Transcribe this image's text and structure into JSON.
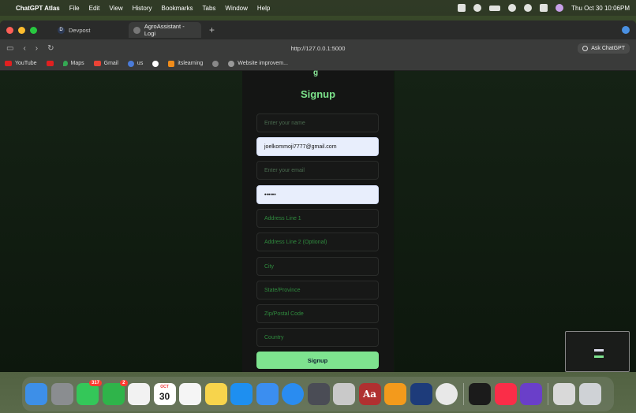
{
  "menubar": {
    "app_name": "ChatGPT Atlas",
    "menus": [
      "File",
      "Edit",
      "View",
      "History",
      "Bookmarks",
      "Tabs",
      "Window",
      "Help"
    ],
    "clock": "Thu Oct 30  10:06PM"
  },
  "browser": {
    "tabs": [
      {
        "label": "Devpost",
        "icon": "devpost-icon"
      },
      {
        "label": "AgroAssistant - Logi",
        "icon": "compass-icon"
      }
    ],
    "url": "http://127.0.0.1:5000",
    "ask_button": "Ask ChatGPT",
    "bookmarks": [
      {
        "label": "YouTube",
        "icon": "youtube-icon",
        "color": "#e02020"
      },
      {
        "label": "",
        "icon": "youtube-icon",
        "color": "#e02020"
      },
      {
        "label": "Maps",
        "icon": "maps-icon",
        "color": "#34a853"
      },
      {
        "label": "Gmail",
        "icon": "gmail-icon",
        "color": "#ea4335"
      },
      {
        "label": "us",
        "icon": "user-icon",
        "color": "#4a7bd8"
      },
      {
        "label": "",
        "icon": "google-icon",
        "color": "#ffffff"
      },
      {
        "label": "itslearning",
        "icon": "itslearning-icon",
        "color": "#f08c1a"
      },
      {
        "label": "",
        "icon": "compass-icon",
        "color": "#aaaaaa"
      },
      {
        "label": "Website improvem...",
        "icon": "gear-icon",
        "color": "#aaaaaa"
      }
    ]
  },
  "form": {
    "title": "Signup",
    "logo_fragment": "g",
    "fields": [
      {
        "name": "name-field",
        "value": "",
        "placeholder": "Enter your name",
        "filled": false
      },
      {
        "name": "username-field",
        "value": "joelkommoji7777@gmail.com",
        "placeholder": "",
        "filled": true
      },
      {
        "name": "email-field",
        "value": "",
        "placeholder": "Enter your email",
        "filled": false
      },
      {
        "name": "password-field",
        "value": "••••••",
        "placeholder": "",
        "filled": true
      },
      {
        "name": "address-line1-field",
        "value": "",
        "placeholder": "Address Line 1",
        "filled": false
      },
      {
        "name": "address-line2-field",
        "value": "",
        "placeholder": "Address Line 2 (Optional)",
        "filled": false
      },
      {
        "name": "city-field",
        "value": "",
        "placeholder": "City",
        "filled": false
      },
      {
        "name": "state-field",
        "value": "",
        "placeholder": "State/Province",
        "filled": false
      },
      {
        "name": "zip-field",
        "value": "",
        "placeholder": "Zip/Postal Code",
        "filled": false
      },
      {
        "name": "country-field",
        "value": "",
        "placeholder": "Country",
        "filled": false
      }
    ],
    "submit_label": "Signup"
  },
  "dock": {
    "apps": [
      {
        "icon": "finder-icon",
        "color": "#3d8fe8",
        "badge": ""
      },
      {
        "icon": "system-settings-icon",
        "color": "#8a8d90",
        "badge": ""
      },
      {
        "icon": "messages-icon",
        "color": "#34c759",
        "badge": "317"
      },
      {
        "icon": "facetime-icon",
        "color": "#2fb44a",
        "badge": "2"
      },
      {
        "icon": "photos-icon",
        "color": "#f2f2f2",
        "badge": ""
      },
      {
        "icon": "calendar-icon",
        "color": "#ffffff",
        "badge": "",
        "month": "OCT",
        "day": "30"
      },
      {
        "icon": "reminders-icon",
        "color": "#f5f5f5",
        "badge": ""
      },
      {
        "icon": "notes-icon",
        "color": "#f7d44c",
        "badge": ""
      },
      {
        "icon": "app-store-icon",
        "color": "#1e8ff0",
        "badge": ""
      },
      {
        "icon": "mail-icon",
        "color": "#3b8ef0",
        "badge": ""
      },
      {
        "icon": "safari-icon",
        "color": "#2a8cf0",
        "badge": ""
      },
      {
        "icon": "iphone-mirroring-icon",
        "color": "#4a4c55",
        "badge": ""
      },
      {
        "icon": "launchpad-icon",
        "color": "#c9c9c9",
        "badge": ""
      },
      {
        "icon": "dictionary-icon",
        "color": "#b03030",
        "badge": "",
        "text": "Aa"
      },
      {
        "icon": "pages-icon",
        "color": "#f39a1c",
        "badge": ""
      },
      {
        "icon": "testflight-icon",
        "color": "#1d3b7a",
        "badge": ""
      },
      {
        "icon": "chrome-icon",
        "color": "#e8e8e8",
        "badge": ""
      },
      {
        "icon": "chatgpt-atlas-icon",
        "color": "#1b1b1b",
        "badge": ""
      },
      {
        "icon": "music-icon",
        "color": "#fa2d48",
        "badge": ""
      },
      {
        "icon": "imovie-icon",
        "color": "#6a3fc9",
        "badge": ""
      },
      {
        "icon": "downloads-icon",
        "color": "#d9d9d9",
        "badge": ""
      },
      {
        "icon": "trash-icon",
        "color": "#cfd2d6",
        "badge": ""
      }
    ]
  }
}
